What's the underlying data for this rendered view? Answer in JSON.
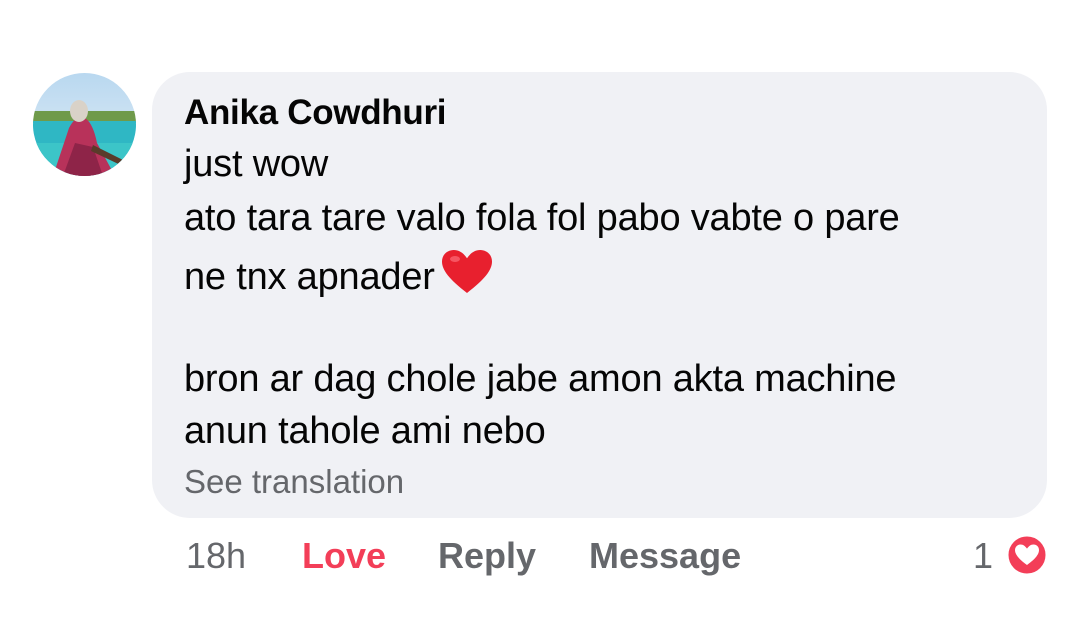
{
  "comment": {
    "author": "Anika Cowdhuri",
    "lines": [
      "just wow",
      "ato tara tare valo fola fol pabo vabte o pare",
      "ne tnx apnader",
      "bron ar dag chole jabe amon akta machine",
      "anun tahole ami nebo"
    ],
    "emoji": "heart-emoji",
    "see_translation": "See translation"
  },
  "actions": {
    "time": "18h",
    "reaction_label": "Love",
    "reply_label": "Reply",
    "message_label": "Message"
  },
  "reactions": {
    "count": "1",
    "type": "love-icon"
  },
  "colors": {
    "bubble": "#f0f1f5",
    "love": "#f33e58",
    "secondary_text": "#65676b",
    "primary_text": "#050505"
  }
}
